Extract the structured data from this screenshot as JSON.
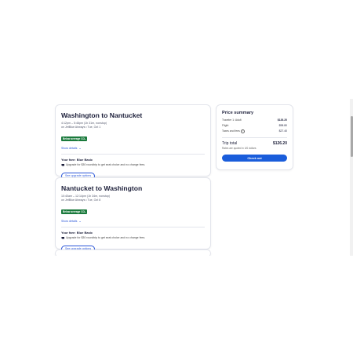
{
  "flights": [
    {
      "title": "Washington to Nantucket",
      "time": "4:12pm – 5:46pm (1h 31m, nonstop)",
      "carrier": "on JetBlue Airways • Tue, Oct 1",
      "badge": "Below average CO₂",
      "details_link": "Show details",
      "fare_title": "Your fare: Blue Basic",
      "fare_desc": "Upgrade for $30 roundtrip to get seat choice and no change fees.",
      "upgrade_button": "See upgrade options"
    },
    {
      "title": "Nantucket to Washington",
      "time": "10:40am – 12:14pm (1h 34m, nonstop)",
      "carrier": "on JetBlue Airways • Tue, Oct 8",
      "badge": "Below average CO₂",
      "details_link": "Show details",
      "fare_title": "Your fare: Blue Basic",
      "fare_desc": "Upgrade for $30 roundtrip to get seat choice and no change fees.",
      "upgrade_button": "See upgrade options"
    }
  ],
  "summary": {
    "title": "Price summary",
    "rows": [
      {
        "label": "Traveler 1: Adult",
        "value": "$126.20",
        "bold": true
      },
      {
        "label": "Flight",
        "value": "$98.80",
        "bold": false
      },
      {
        "label": "Taxes and fees",
        "value": "$27.40",
        "bold": false
      }
    ],
    "total_label": "Trip total",
    "total_value": "$126.20",
    "note": "Rates are quoted in US dollars",
    "checkout_button": "Check out"
  },
  "icons": {
    "chevron": "chevron-down-icon",
    "tag": "tag-icon",
    "info": "info-icon"
  },
  "colors": {
    "accent": "#1a5ddb",
    "link": "#2a56d8",
    "eco_badge": "#1a7a3c"
  }
}
